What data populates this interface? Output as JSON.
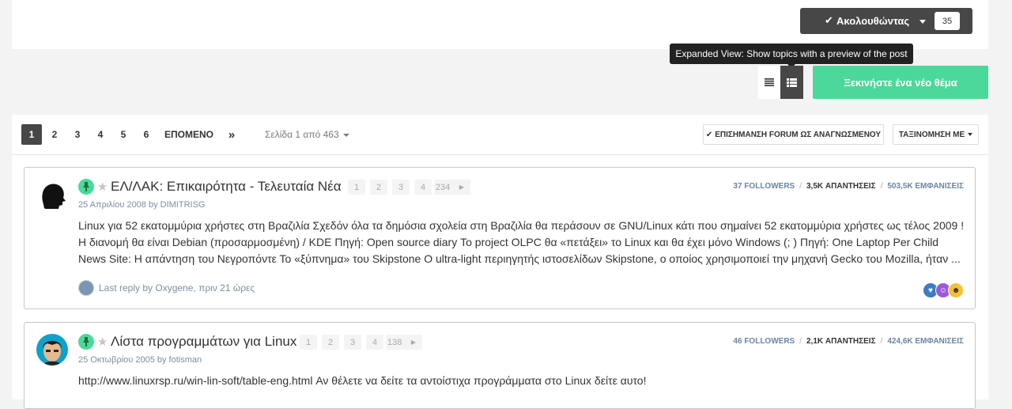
{
  "follow": {
    "label": "Ακολουθώντας",
    "count": "35"
  },
  "tooltip": "Expanded View: Show topics with a preview of the post",
  "new_topic_label": "Ξεκινήστε ένα νέο θέμα",
  "pagination": {
    "pages": [
      "1",
      "2",
      "3",
      "4",
      "5",
      "6"
    ],
    "next_label": "ΕΠΟΜΕΝΟ",
    "last_label": "»",
    "page_info": "Σελίδα 1 από 463"
  },
  "mark_read_label": "ΕΠΙΣΗΜΑΝΣΗ FORUM ΩΣ ΑΝΑΓΝΩΣΜΕΝΟΥ",
  "sort_label": "ΤΑΞΙΝΟΜΗΣΗ ΜΕ",
  "topics": [
    {
      "title": "ΕΛ/ΛΑΚ: Επικαιρότητα - Τελευταία Νέα",
      "pages": [
        "1",
        "2",
        "3",
        "4",
        "234"
      ],
      "meta": "25 Απριλίου 2008 by DIMITRISG",
      "followers": "37 FOLLOWERS",
      "replies": "3,5K ΑΠΑΝΤΗΣΕΙΣ",
      "views": "503,5K ΕΜΦΑΝΙΣΕΙΣ",
      "snippet": "Linux για 52 εκατομμύρια χρήστες στη Βραζιλία Σχεδόν όλα τα δημόσια σχολεία στη Βραζιλία θα περάσουν σε GNU/Linux κάτι που σημαίνει 52 εκατομμύρια χρήστες ως τέλος 2009 ! Η διανομή θα είναι Debian (προσαρμοσμένη) / KDE Πηγή: Open source diary Το project OLPC θα «πετάξει» το Linux και θα έχει μόνο Windows (; ) Πηγή: One Laptop Per Child News Site: Η απάντηση του Νεγροπόντε Το «ξύπνημα» του Skipstone O ultra-light περιηγητής ιστοσελίδων Skipstone, ο οποίος χρησιμοποιεί την μηχανή Gecko του Mozilla, ήταν ...",
      "last_reply": "Last reply by Oxygene, πριν 21 ώρες"
    },
    {
      "title": "Λίστα προγραμμάτων για Linux",
      "pages": [
        "1",
        "2",
        "3",
        "4",
        "138"
      ],
      "meta": "25 Οκτωβρίου 2005 by fotisman",
      "followers": "46 FOLLOWERS",
      "replies": "2,1K ΑΠΑΝΤΗΣΕΙΣ",
      "views": "424,6K ΕΜΦΑΝΙΣΕΙΣ",
      "snippet": "http://www.linuxrsp.ru/win-lin-soft/table-eng.html Αν θέλετε να δείτε τα αντοίστιχα προγράμματα στο Linux δείτε αυτο!"
    }
  ]
}
